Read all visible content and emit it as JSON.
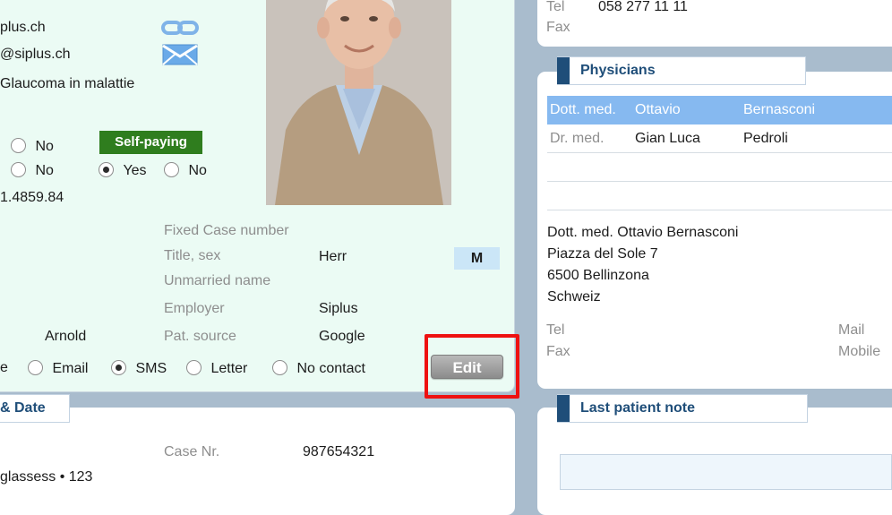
{
  "patient": {
    "website": "plus.ch",
    "email": "@siplus.ch",
    "diagnosis": "Glaucoma in malattie",
    "row1_no": "No",
    "self_paying": "Self-paying",
    "row2_no": "No",
    "row2_yes": "Yes",
    "row2_no2": "No",
    "number": "1.4859.84",
    "first_name": "Arnold",
    "fields": {
      "fixed_case_label": "Fixed Case number",
      "title_sex_label": "Title, sex",
      "title_value": "Herr",
      "sex_value": "M",
      "unmarried_label": "Unmarried name",
      "employer_label": "Employer",
      "employer_value": "Siplus",
      "source_label": "Pat. source",
      "source_value": "Google"
    },
    "contact": {
      "partial": "e",
      "email": "Email",
      "sms": "SMS",
      "letter": "Letter",
      "no_contact": "No contact"
    },
    "edit_label": "Edit"
  },
  "case": {
    "header": "& Date",
    "case_nr_label": "Case Nr.",
    "case_nr_value": "987654321",
    "item_text": "glassess • 123"
  },
  "contact_top": {
    "tel_label": "Tel",
    "tel_value": "058 277 11 11",
    "fax_label": "Fax"
  },
  "physicians": {
    "header": "Physicians",
    "rows": [
      {
        "title": "Dott. med.",
        "first": "Ottavio",
        "last": "Bernasconi"
      },
      {
        "title": "Dr. med.",
        "first": "Gian Luca",
        "last": "Pedroli"
      }
    ],
    "address": {
      "line1": "Dott. med. Ottavio Bernasconi",
      "line2": "Piazza del Sole 7",
      "line3": "6500 Bellinzona",
      "line4": "Schweiz"
    },
    "tel_label": "Tel",
    "fax_label": "Fax",
    "mail_label": "Mail",
    "mobile_label": "Mobile"
  },
  "note": {
    "header": "Last patient note"
  },
  "colors": {
    "background": "#a9bccd",
    "patient_panel": "#ebfbf4",
    "header_text": "#1f4e79",
    "self_paying": "#2f7d1e",
    "selected_row": "#86b9f0",
    "highlight": "#ee1111"
  },
  "icons": [
    "link-icon",
    "mail-icon"
  ]
}
